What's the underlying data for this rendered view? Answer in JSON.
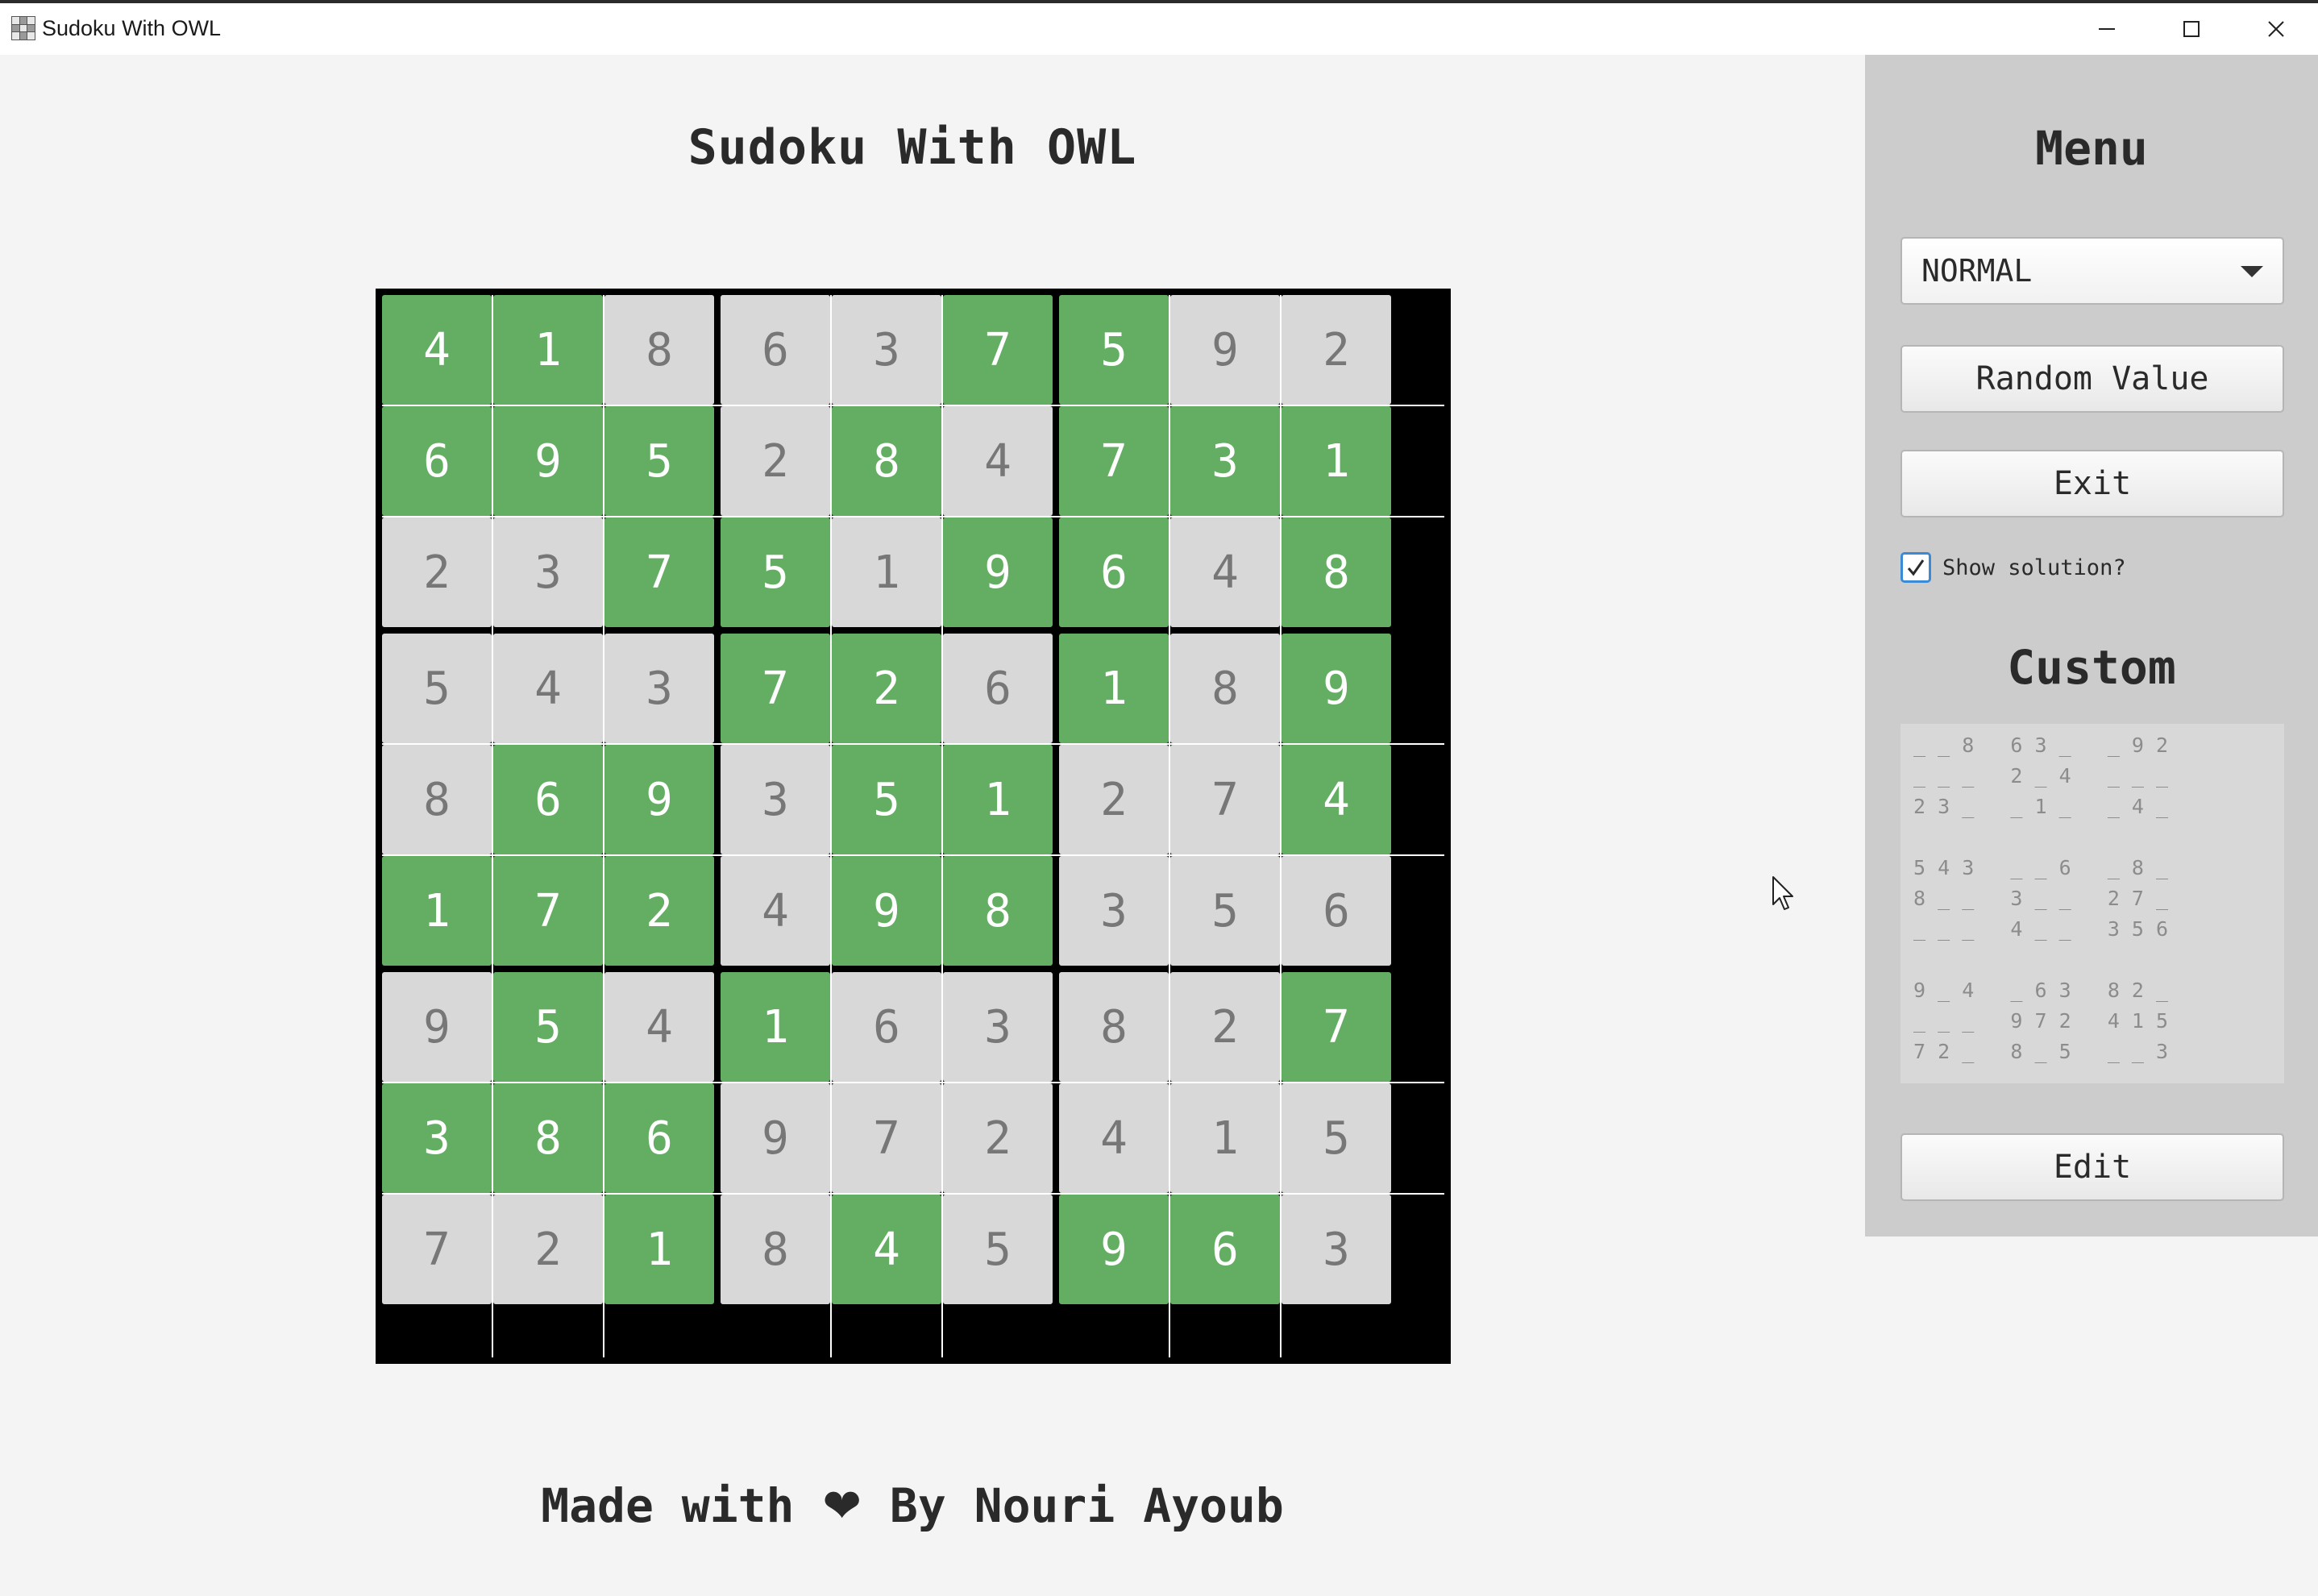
{
  "window": {
    "title": "Sudoku With OWL",
    "icons": {
      "minimize": "minimize-icon",
      "maximize": "maximize-icon",
      "close": "close-icon"
    }
  },
  "main": {
    "title": "Sudoku With OWL",
    "footer_prefix": "Made with",
    "footer_heart": "❤",
    "footer_suffix": "By Nouri Ayoub"
  },
  "board": {
    "values": [
      [
        4,
        1,
        8,
        6,
        3,
        7,
        5,
        9,
        2
      ],
      [
        6,
        9,
        5,
        2,
        8,
        4,
        7,
        3,
        1
      ],
      [
        2,
        3,
        7,
        5,
        1,
        9,
        6,
        4,
        8
      ],
      [
        5,
        4,
        3,
        7,
        2,
        6,
        1,
        8,
        9
      ],
      [
        8,
        6,
        9,
        3,
        5,
        1,
        2,
        7,
        4
      ],
      [
        1,
        7,
        2,
        4,
        9,
        8,
        3,
        5,
        6
      ],
      [
        9,
        5,
        4,
        1,
        6,
        3,
        8,
        2,
        7
      ],
      [
        3,
        8,
        6,
        9,
        7,
        2,
        4,
        1,
        5
      ],
      [
        7,
        2,
        1,
        8,
        4,
        5,
        9,
        6,
        3
      ]
    ],
    "solved": [
      [
        1,
        1,
        0,
        0,
        0,
        1,
        1,
        0,
        0
      ],
      [
        1,
        1,
        1,
        0,
        1,
        0,
        1,
        1,
        1
      ],
      [
        0,
        0,
        1,
        1,
        0,
        1,
        1,
        0,
        1
      ],
      [
        0,
        0,
        0,
        1,
        1,
        0,
        1,
        0,
        1
      ],
      [
        0,
        1,
        1,
        0,
        1,
        1,
        0,
        0,
        1
      ],
      [
        1,
        1,
        1,
        0,
        1,
        1,
        0,
        0,
        0
      ],
      [
        0,
        1,
        0,
        1,
        0,
        0,
        0,
        0,
        1
      ],
      [
        1,
        1,
        1,
        0,
        0,
        0,
        0,
        0,
        0
      ],
      [
        0,
        0,
        1,
        0,
        1,
        0,
        1,
        1,
        0
      ]
    ],
    "colors": {
      "solved": "#63ae62",
      "given": "#d8d8d8",
      "solved_text": "#ffffff",
      "given_text": "#777777"
    }
  },
  "sidebar": {
    "menu_title": "Menu",
    "difficulty": {
      "selected": "NORMAL"
    },
    "random_button": "Random Value",
    "exit_button": "Exit",
    "show_solution": {
      "label": "Show solution?",
      "checked": true
    },
    "custom_title": "Custom",
    "custom_lines": [
      "_ _ 8   6 3 _   _ 9 2",
      "_ _ _   2 _ 4   _ _ _",
      "2 3 _   _ 1 _   _ 4 _",
      "",
      "5 4 3   _ _ 6   _ 8 _",
      "8 _ _   3 _ _   2 7 _",
      "_ _ _   4 _ _   3 5 6",
      "",
      "9 _ 4   _ 6 3   8 2 _",
      "_ _ _   9 7 2   4 1 5",
      "7 2 _   8 _ 5   _ _ 3"
    ],
    "edit_button": "Edit"
  }
}
